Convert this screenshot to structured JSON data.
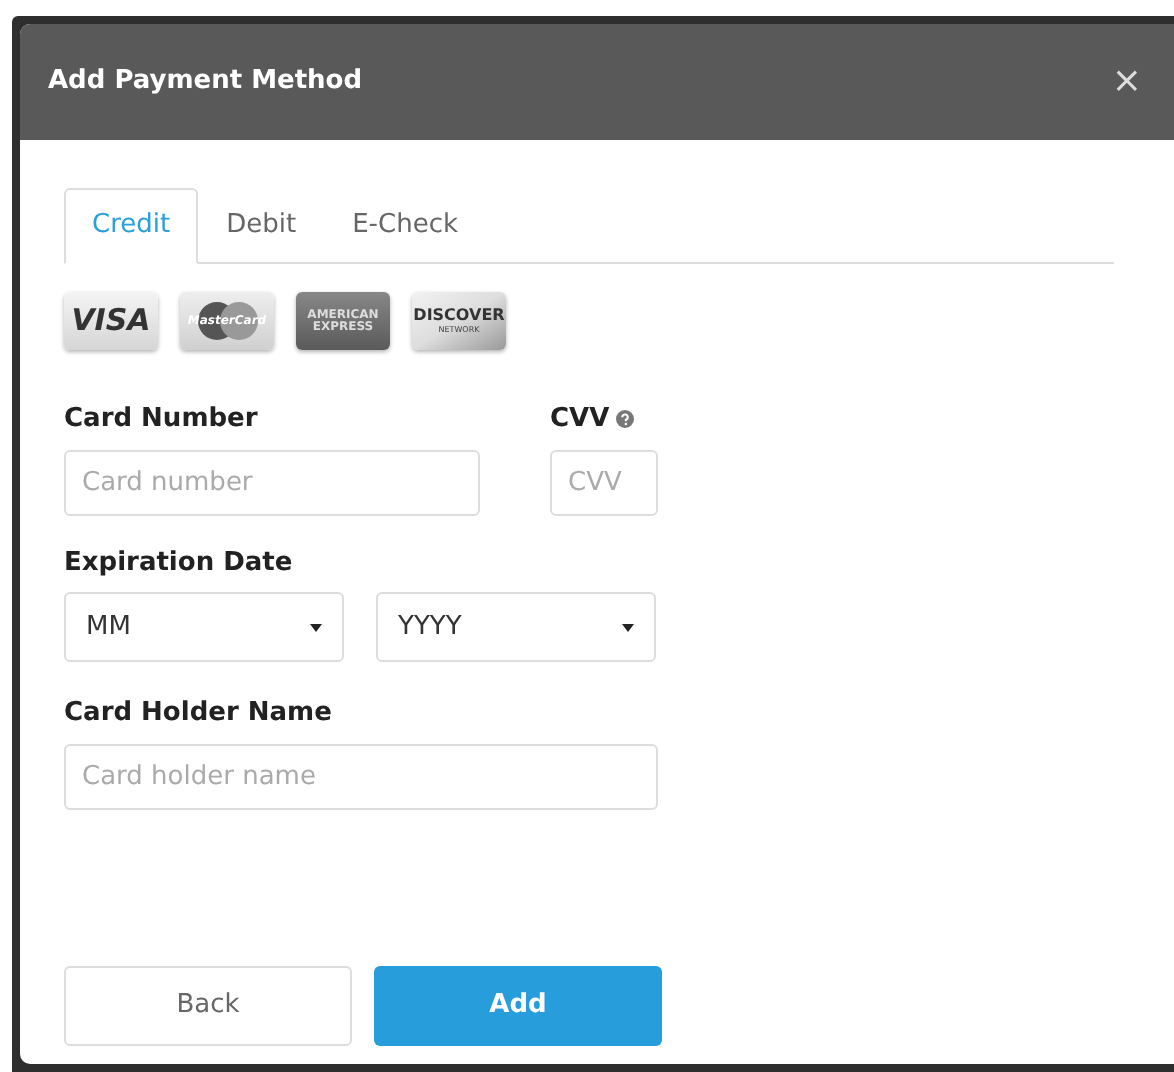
{
  "dialog": {
    "title": "Add Payment Method",
    "close": "×"
  },
  "tabs": [
    {
      "label": "Credit",
      "selected": true
    },
    {
      "label": "Debit",
      "selected": false
    },
    {
      "label": "E-Check",
      "selected": false
    }
  ],
  "card_logos": [
    {
      "kind": "visa",
      "text": "VISA"
    },
    {
      "kind": "mastercard",
      "text": "MasterCard"
    },
    {
      "kind": "amex",
      "text": "AMERICAN EXPRESS"
    },
    {
      "kind": "discover",
      "text": "DISCOVER",
      "subtext": "NETWORK"
    }
  ],
  "card_number": {
    "label": "Card Number",
    "placeholder": "Card number"
  },
  "cvv": {
    "label": "CVV",
    "placeholder": "CVV"
  },
  "expiration": {
    "label": "Expiration Date",
    "month": "MM",
    "year": "YYYY"
  },
  "card_holder": {
    "label": "Card Holder Name",
    "placeholder": "Card holder name"
  },
  "buttons": {
    "back": "Back",
    "add": "Add"
  }
}
